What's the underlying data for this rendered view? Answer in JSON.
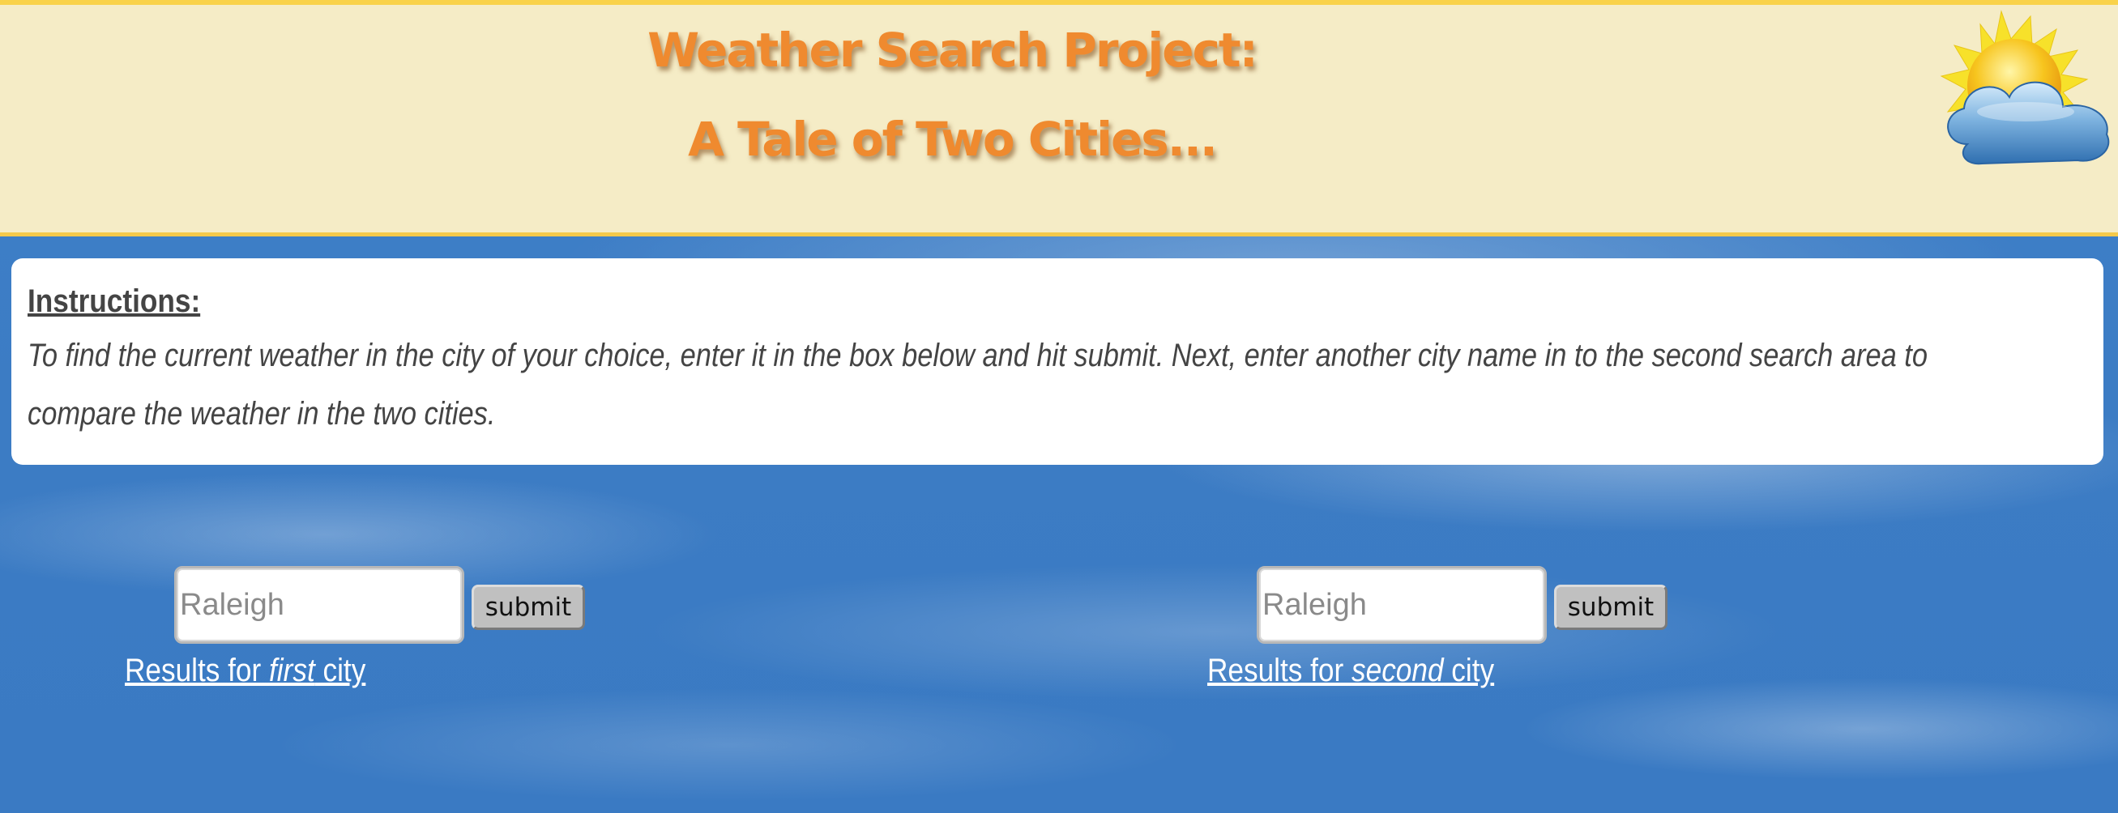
{
  "header": {
    "title_line1": "Weather Search Project:",
    "title_line2": "A Tale of Two Cities...",
    "logo_icon": "sun-behind-cloud-icon"
  },
  "instructions": {
    "heading": "Instructions:",
    "body": "To find the current weather in the city of your choice, enter it in the box below and hit submit. Next, enter another city name in to the second search area to compare the weather in the two cities."
  },
  "search_first": {
    "placeholder": "Raleigh",
    "value": "",
    "submit_label": "submit",
    "results_prefix": "Results for ",
    "results_emphasis": "first",
    "results_suffix": " city"
  },
  "search_second": {
    "placeholder": "Raleigh",
    "value": "",
    "submit_label": "submit",
    "results_prefix": "Results for ",
    "results_emphasis": "second",
    "results_suffix": " city"
  },
  "colors": {
    "header_bg": "#f5ecc6",
    "header_border": "#f9d24a",
    "title_orange": "#ef8a2f",
    "sky_blue": "#3d7fc7",
    "button_gray": "#c0c0c0"
  }
}
